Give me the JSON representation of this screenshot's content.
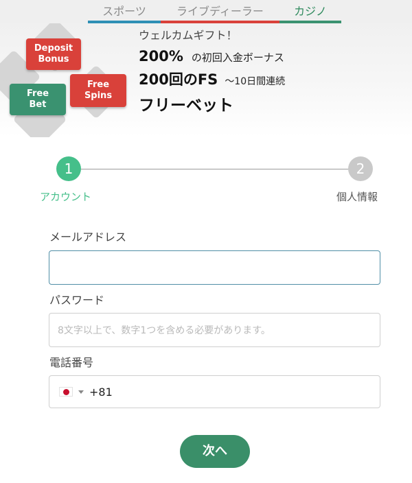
{
  "tabs": [
    {
      "label": "スポーツ",
      "accent": "#2e8fb5"
    },
    {
      "label": "ライブディーラー",
      "accent": "#d9413a"
    },
    {
      "label": "カジノ",
      "accent": "#3a9270"
    }
  ],
  "banner": {
    "chips": {
      "deposit_line1": "Deposit",
      "deposit_line2": "Bonus",
      "spins_line1": "Free",
      "spins_line2": "Spins",
      "bet_line1": "Free",
      "bet_line2": "Bet"
    },
    "welcome": "ウェルカムギフト！",
    "bonus_percent": "200%",
    "bonus_text": "の初回入金ボーナス",
    "fs_count": "200回のFS",
    "fs_text": "〜10日間連続",
    "freebet": "フリーベット"
  },
  "stepper": {
    "steps": [
      {
        "number": "1",
        "label": "アカウント",
        "status": "active"
      },
      {
        "number": "2",
        "label": "個人情報",
        "status": "inactive"
      }
    ]
  },
  "form": {
    "email_label": "メールアドレス",
    "email_value": "",
    "password_label": "パスワード",
    "password_placeholder": "8文字以上で、数字1つを含める必要があります。",
    "phone_label": "電話番号",
    "phone_dial_code": "+81",
    "phone_flag": "japan-flag-icon"
  },
  "actions": {
    "next_label": "次へ"
  },
  "colors": {
    "green": "#3a8f69",
    "active_step": "#45bf8a",
    "red": "#d9413a"
  }
}
